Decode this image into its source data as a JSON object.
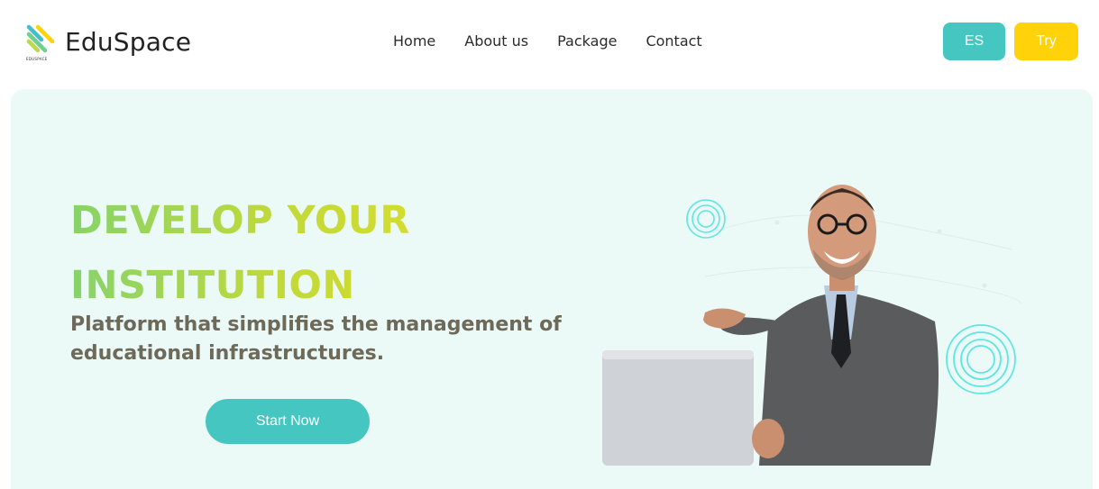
{
  "brand": {
    "name": "EduSpace",
    "mini_text": "EDUSPACE"
  },
  "nav": {
    "items": [
      {
        "label": "Home"
      },
      {
        "label": "About us"
      },
      {
        "label": "Package"
      },
      {
        "label": "Contact"
      }
    ]
  },
  "actions": {
    "language_label": "ES",
    "try_label": "Try"
  },
  "hero": {
    "headline_line1": "DEVELOP YOUR",
    "headline_line2": "INSTITUTION",
    "subtitle": "Platform that simplifies the management of educational infrastructures.",
    "cta_label": "Start Now",
    "image_icon": "businessman-with-laptop-illustration"
  },
  "colors": {
    "accent_teal": "#46c6c1",
    "accent_yellow": "#ffd20a",
    "hero_background": "#ebf9f7",
    "headline_gradient_start": "#86d36a",
    "headline_gradient_end": "#d4dc2f",
    "subtitle_color": "#6d6a5a"
  }
}
